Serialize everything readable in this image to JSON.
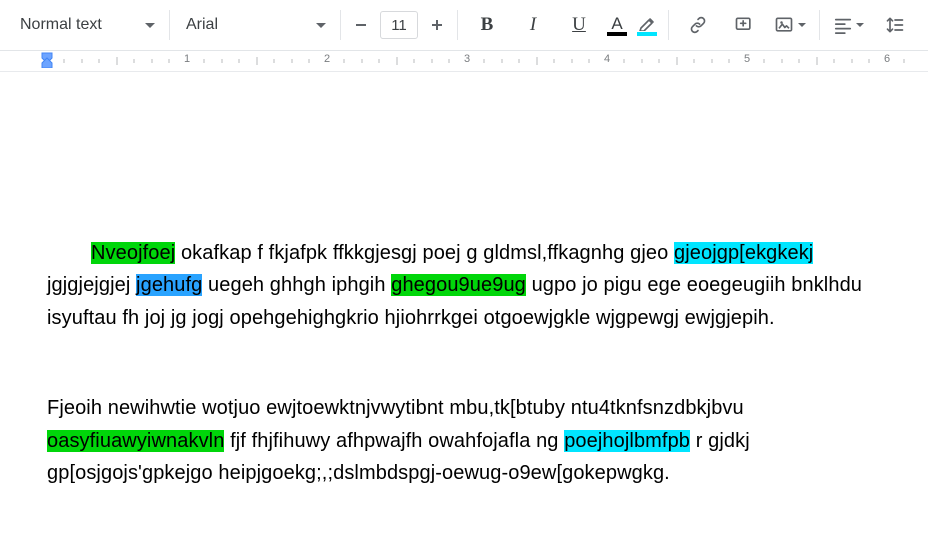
{
  "toolbar": {
    "styles": {
      "label": "Normal text"
    },
    "font": {
      "label": "Arial"
    },
    "fontSize": "11",
    "bold_glyph": "B",
    "italic_glyph": "I",
    "underline_glyph": "U",
    "textcolor_glyph": "A",
    "textcolor_bar": "#000000",
    "highlight_bar": "#00e5ff"
  },
  "ruler": {
    "labels": [
      "1",
      "2",
      "3",
      "4",
      "5",
      "6"
    ]
  },
  "doc": {
    "p1": {
      "seg1": "Nveojfoej",
      "seg2": "  okafkap f fkjafpk ffkkgjesgj poej g gldmsl,ffkagnhg gjeo ",
      "seg3": "gjeojgp[ekgkekj",
      "seg4": " jgjgjejgjej ",
      "seg5": "jgehufg",
      "seg6": " uegeh ghhgh iphgih ",
      "seg7": "ghegou9ue9ug",
      "seg8": " ugpo jo pigu ege  eoegeugiih bnklhdu isyuftau fh joj jg  jogj opehgehighgkrio hjiohrrkgei otgoewjgkle wjgpewgj ewjgjepih."
    },
    "p2": {
      "seg1": "Fjeoih newihwtie wotjuo ewjtoewktnjvwytibnt  mbu,tk[btuby ntu4tknfsnzdbkjbvu ",
      "seg2": "oasyfiuawyiwnakvln",
      "seg3": " fjf fhjfihuwy  afhpwajfh owahfojafla ng ",
      "seg4": "poejhojlbmfpb",
      "seg5": " r gjdkj gp[osjgojs'gpkejgo heipjgoekg;,;dslmbdspgj-oewug-o9ew[gokepwgkg."
    }
  }
}
